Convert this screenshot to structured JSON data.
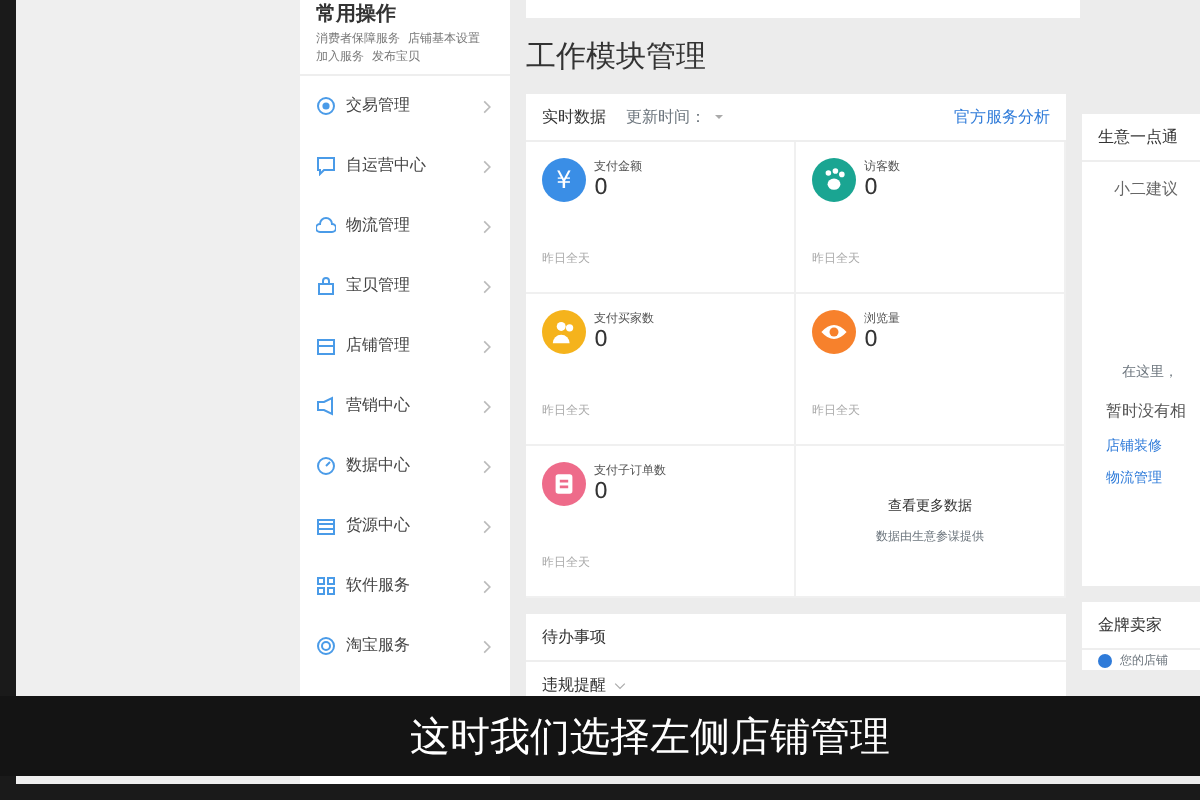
{
  "quick_ops": {
    "title": "常用操作",
    "links": [
      "消费者保障服务",
      "店铺基本设置",
      "加入服务",
      "发布宝贝"
    ]
  },
  "sidebar": {
    "items": [
      {
        "label": "交易管理",
        "kind": "dot"
      },
      {
        "label": "自运营中心",
        "kind": "chat"
      },
      {
        "label": "物流管理",
        "kind": "cloud"
      },
      {
        "label": "宝贝管理",
        "kind": "bag"
      },
      {
        "label": "店铺管理",
        "kind": "store"
      },
      {
        "label": "营销中心",
        "kind": "megaphone"
      },
      {
        "label": "数据中心",
        "kind": "gauge"
      },
      {
        "label": "货源中心",
        "kind": "box"
      },
      {
        "label": "软件服务",
        "kind": "grid"
      },
      {
        "label": "淘宝服务",
        "kind": "circle"
      }
    ]
  },
  "main": {
    "title": "工作模块管理",
    "realtime": {
      "title": "实时数据",
      "update_label": "更新时间：",
      "link": "官方服务分析",
      "metrics": [
        {
          "label": "支付金额",
          "value": "0",
          "period": "昨日全天",
          "color": "#3a8ee6",
          "kind": "text",
          "glyph": "¥"
        },
        {
          "label": "访客数",
          "value": "0",
          "period": "昨日全天",
          "color": "#1aa592",
          "kind": "paw"
        },
        {
          "label": "支付买家数",
          "value": "0",
          "period": "昨日全天",
          "color": "#f5b31c",
          "kind": "people"
        },
        {
          "label": "浏览量",
          "value": "0",
          "period": "昨日全天",
          "color": "#f7812c",
          "kind": "eye"
        },
        {
          "label": "支付子订单数",
          "value": "0",
          "period": "昨日全天",
          "color": "#ee6b8a",
          "kind": "doc"
        }
      ],
      "more": {
        "title": "查看更多数据",
        "note": "数据由生意参谋提供"
      }
    },
    "todo": {
      "title": "待办事项",
      "tab": "违规提醒"
    }
  },
  "right": {
    "title": "生意一点通",
    "tab": "小二建议",
    "hint": "在这里，",
    "empty": "暂时没有相",
    "links": [
      "店铺装修",
      "物流管理"
    ],
    "gold": {
      "title": "金牌卖家",
      "note": "您的店铺"
    }
  },
  "subtitle": "这时我们选择左侧店铺管理"
}
